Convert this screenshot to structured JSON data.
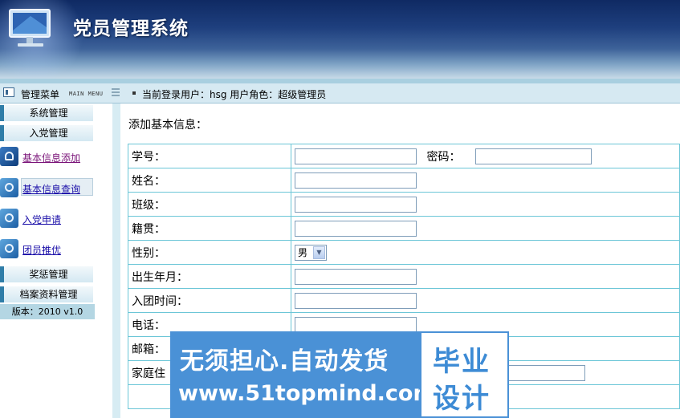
{
  "header": {
    "title": "党员管理系统"
  },
  "navbar": {
    "menu_label": "管理菜单",
    "menu_en": "MAIN MENU",
    "user_text": "当前登录用户：hsg   用户角色：超级管理员"
  },
  "sidebar": {
    "sections": [
      {
        "label": "系统管理"
      },
      {
        "label": "入党管理"
      },
      {
        "label": "奖惩管理"
      },
      {
        "label": "档案资料管理"
      }
    ],
    "items": [
      {
        "label": "基本信息添加",
        "icon": "person-icon"
      },
      {
        "label": "基本信息查询",
        "icon": "gear-icon"
      },
      {
        "label": "入党申请",
        "icon": "gear-icon"
      },
      {
        "label": "团员推优",
        "icon": "gear-icon"
      }
    ],
    "version": "版本：2010 v1.0"
  },
  "main": {
    "title": "添加基本信息：",
    "fields": {
      "student_id": "学号：",
      "password": "密码：",
      "name": "姓名：",
      "class": "班级：",
      "native_place": "籍贯：",
      "gender": "性别：",
      "gender_value": "男",
      "birth": "出生年月：",
      "league_date": "入团时间：",
      "phone": "电话：",
      "email": "邮箱：",
      "address": "家庭住"
    }
  },
  "watermark": {
    "line1": "无须担心.自动发货",
    "line2": "www.51topmind.com",
    "box_line1": "毕业",
    "box_line2": "设计"
  }
}
